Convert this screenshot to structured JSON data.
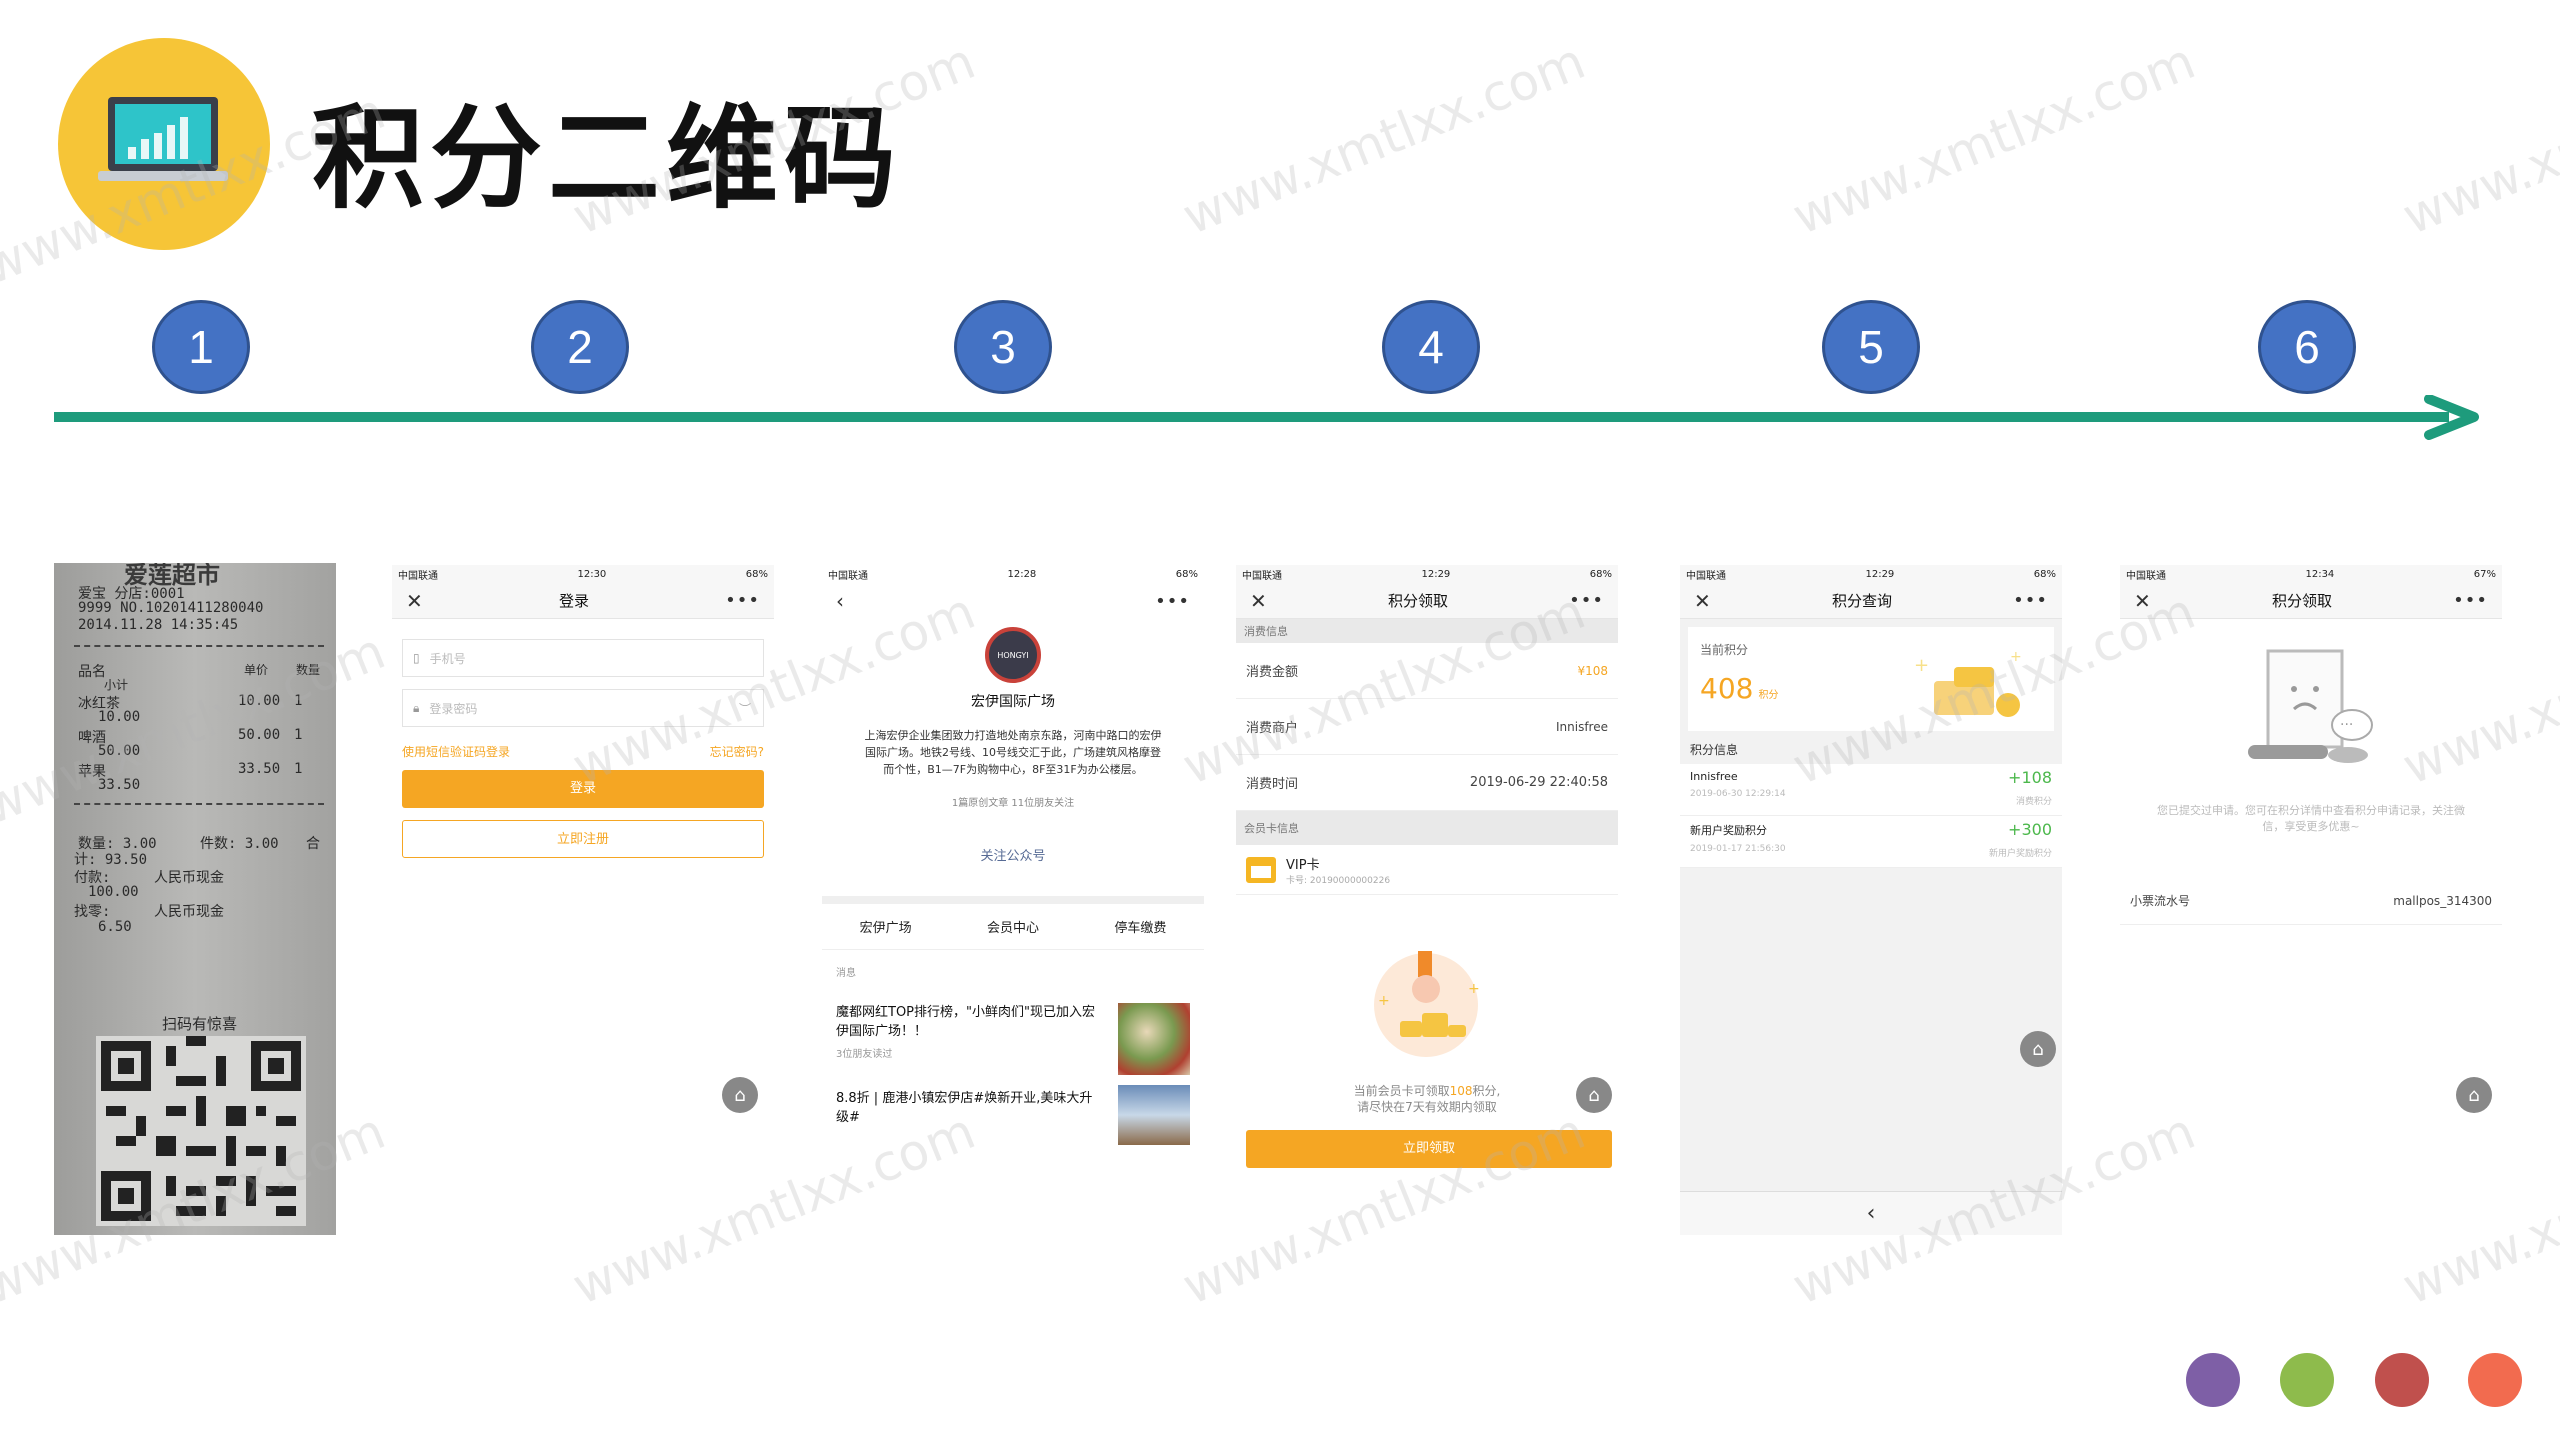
{
  "title": "积分二维码",
  "watermark": "www.xmtlxx.com",
  "steps": [
    "1",
    "2",
    "3",
    "4",
    "5",
    "6"
  ],
  "colors": {
    "accent": "#1e9b7c",
    "step": "#4472c4",
    "orange": "#f5a623",
    "logo": "#f6c537"
  },
  "receipt": {
    "header": "爱莲超市",
    "store_line": "爱宝   分店:0001",
    "order_line": "9999 NO.10201411280040",
    "date_line": "2014.11.28 14:35:45",
    "col_name": "品名",
    "col_price": "单价",
    "col_qty": "数量",
    "col_subtotal": "小计",
    "items": [
      {
        "name": "冰红茶",
        "price": "10.00",
        "qty": "1",
        "subtotal": "10.00"
      },
      {
        "name": "啤酒",
        "price": "50.00",
        "qty": "1",
        "subtotal": "50.00"
      },
      {
        "name": "苹果",
        "price": "33.50",
        "qty": "1",
        "subtotal": "33.50"
      }
    ],
    "qty_line": "数量: 3.00",
    "pieces_line": "件数: 3.00",
    "total_mark": "合",
    "total_line": "计: 93.50",
    "paid_line": "付款:",
    "paid_method": "人民币现金",
    "paid_amount": "100.00",
    "change_line": "找零:",
    "change_method": "人民币现金",
    "change_amount": "6.50",
    "scan_text": "扫码有惊喜"
  },
  "phone2": {
    "carrier": "中国联通",
    "time": "12:30",
    "battery": "68%",
    "nav_title": "登录",
    "phone_placeholder": "手机号",
    "password_placeholder": "登录密码",
    "sms_login": "使用短信验证码登录",
    "forgot": "忘记密码?",
    "login_btn": "登录",
    "register_btn": "立即注册"
  },
  "phone3": {
    "carrier": "中国联通",
    "time": "12:28",
    "battery": "68%",
    "account_name": "宏伊国际广场",
    "logo_text": "HONGYI",
    "description": "上海宏伊企业集团致力打造地处南京东路，河南中路口的宏伊国际广场。地铁2号线、10号线交汇于此，广场建筑风格摩登而个性，B1—7F为购物中心，8F至31F为办公楼层。",
    "stats": "1篇原创文章  11位朋友关注",
    "follow": "关注公众号",
    "menu": [
      "宏伊广场",
      "会员中心",
      "停车缴费"
    ],
    "msg_label": "消息",
    "articles": [
      {
        "title": "魔都网红TOP排行榜，\"小鲜肉们\"现已加入宏伊国际广场！！",
        "meta": "3位朋友读过"
      },
      {
        "title": "8.8折 | 鹿港小镇宏伊店#焕新开业,美味大升级#",
        "meta": ""
      }
    ]
  },
  "phone4": {
    "carrier": "中国联通",
    "time": "12:29",
    "battery": "68%",
    "nav_title": "积分领取",
    "section1": "消费信息",
    "amount_label": "消费金额",
    "amount_value": "¥108",
    "merchant_label": "消费商户",
    "merchant_value": "Innisfree",
    "time_label": "消费时间",
    "time_value": "2019-06-29 22:40:58",
    "section2": "会员卡信息",
    "card_name": "VIP卡",
    "card_no": "卡号: 20190000000226",
    "notice_a": "当前会员卡可领取",
    "notice_points": "108",
    "notice_b": "积分,",
    "notice_line2": "请尽快在7天有效期内领取",
    "claim_btn": "立即领取"
  },
  "phone5": {
    "carrier": "中国联通",
    "time": "12:29",
    "battery": "68%",
    "nav_title": "积分查询",
    "current_label": "当前积分",
    "current_value": "408",
    "current_unit": "积分",
    "info_label": "积分信息",
    "records": [
      {
        "name": "Innisfree",
        "date": "2019-06-30 12:29:14",
        "points": "+108",
        "type": "消费积分"
      },
      {
        "name": "新用户奖励积分",
        "date": "2019-01-17 21:56:30",
        "points": "+300",
        "type": "新用户奖励积分"
      }
    ],
    "back": "‹"
  },
  "phone6": {
    "carrier": "中国联通",
    "time": "12:34",
    "battery": "67%",
    "nav_title": "积分领取",
    "message": "您已提交过申请。您可在积分详情中查看积分申请记录，关注微信，享受更多优惠~",
    "serial_label": "小票流水号",
    "serial_value": "mallpos_314300"
  },
  "corner_dots": [
    "#7e5fa6",
    "#8ebb4c",
    "#c0504d",
    "#f26b4f"
  ]
}
